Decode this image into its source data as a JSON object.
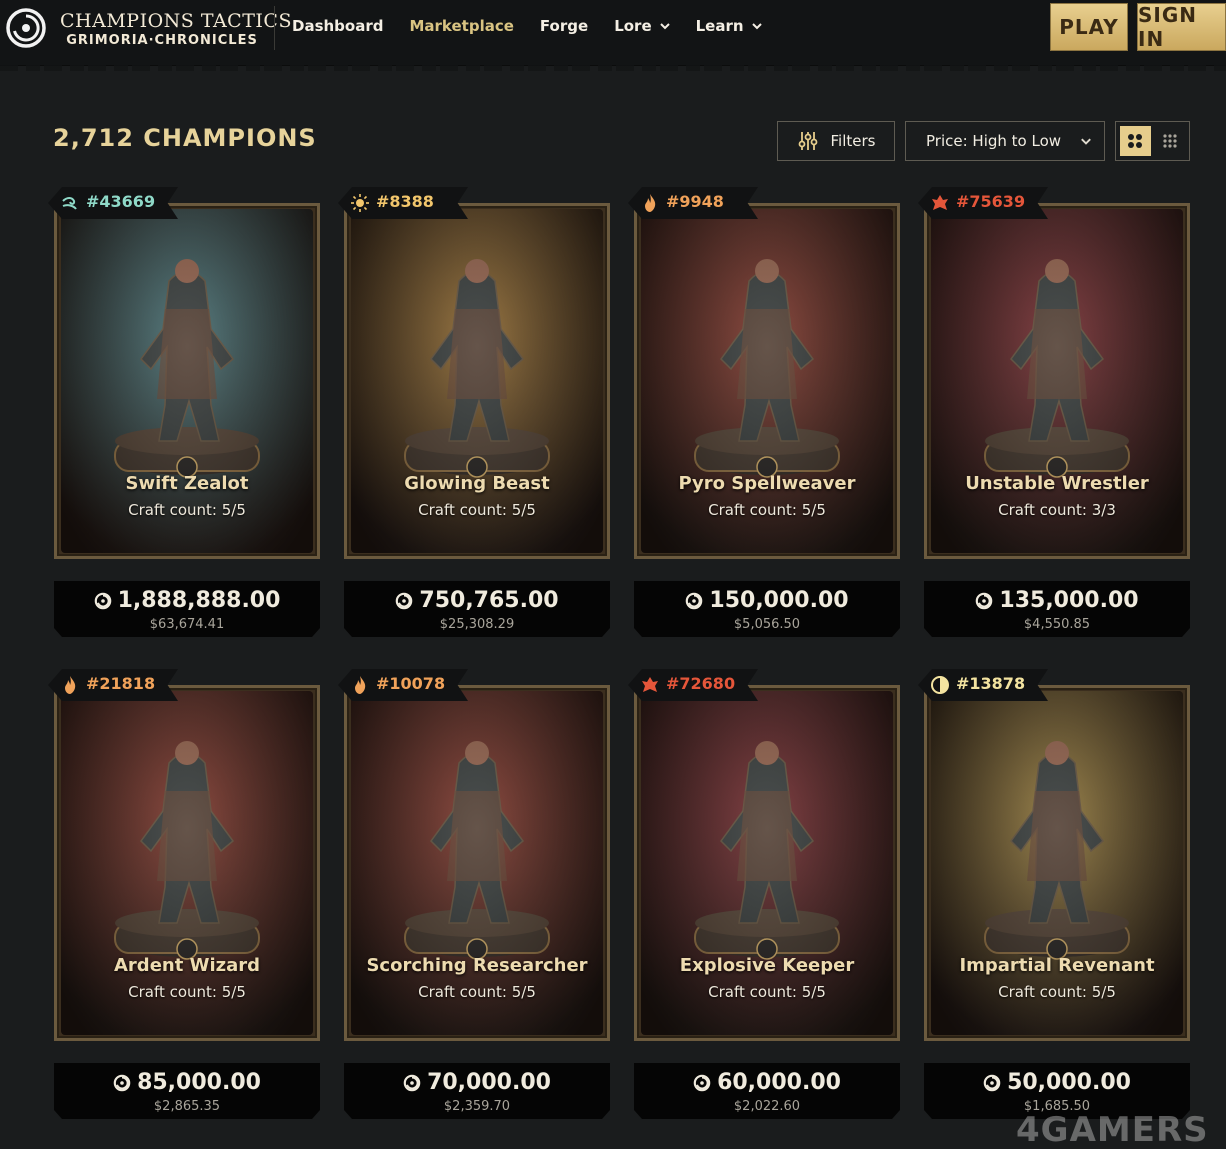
{
  "header": {
    "brand_title": "CHAMPIONS TACTICS",
    "brand_subtitle": "GRIMORIA·CHRONICLES",
    "nav": [
      {
        "label": "Dashboard",
        "active": false,
        "dropdown": false
      },
      {
        "label": "Marketplace",
        "active": true,
        "dropdown": false
      },
      {
        "label": "Forge",
        "active": false,
        "dropdown": false
      },
      {
        "label": "Lore",
        "active": false,
        "dropdown": true
      },
      {
        "label": "Learn",
        "active": false,
        "dropdown": true
      }
    ],
    "play_label": "PLAY",
    "signin_label": "SIGN IN"
  },
  "toolbar": {
    "count_title": "2,712 CHAMPIONS",
    "filters_label": "Filters",
    "sort_value": "Price: High to Low",
    "view_mode": "grid-large"
  },
  "cards": [
    {
      "id": "#43669",
      "element": "air",
      "id_color": "#8fd9c8",
      "name": "Swift Zealot",
      "craft": "Craft count: 5/5",
      "price": "1,888,888.00",
      "usd": "$63,674.41",
      "bg": "#3f6a6e"
    },
    {
      "id": "#8388",
      "element": "light",
      "id_color": "#f2c66c",
      "name": "Glowing Beast",
      "craft": "Craft count: 5/5",
      "price": "750,765.00",
      "usd": "$25,308.29",
      "bg": "#8a6226"
    },
    {
      "id": "#9948",
      "element": "fire",
      "id_color": "#f0a25a",
      "name": "Pyro Spellweaver",
      "craft": "Craft count: 5/5",
      "price": "150,000.00",
      "usd": "$5,056.50",
      "bg": "#7a2e22"
    },
    {
      "id": "#75639",
      "element": "chaos",
      "id_color": "#e5563a",
      "name": "Unstable Wrestler",
      "craft": "Craft count: 3/3",
      "price": "135,000.00",
      "usd": "$4,550.85",
      "bg": "#6e2226"
    },
    {
      "id": "#21818",
      "element": "fire",
      "id_color": "#f0a25a",
      "name": "Ardent Wizard",
      "craft": "Craft count: 5/5",
      "price": "85,000.00",
      "usd": "$2,865.35",
      "bg": "#7a2e22"
    },
    {
      "id": "#10078",
      "element": "fire",
      "id_color": "#f0a25a",
      "name": "Scorching Researcher",
      "craft": "Craft count: 5/5",
      "price": "70,000.00",
      "usd": "$2,359.70",
      "bg": "#7a2e22"
    },
    {
      "id": "#72680",
      "element": "chaos",
      "id_color": "#e5563a",
      "name": "Explosive Keeper",
      "craft": "Craft count: 5/5",
      "price": "60,000.00",
      "usd": "$2,022.60",
      "bg": "#6e2226"
    },
    {
      "id": "#13878",
      "element": "balance",
      "id_color": "#f3e3a0",
      "name": "Impartial Revenant",
      "craft": "Craft count: 5/5",
      "price": "50,000.00",
      "usd": "$1,685.50",
      "bg": "#8c7131"
    }
  ],
  "watermark": "4GAMERS"
}
